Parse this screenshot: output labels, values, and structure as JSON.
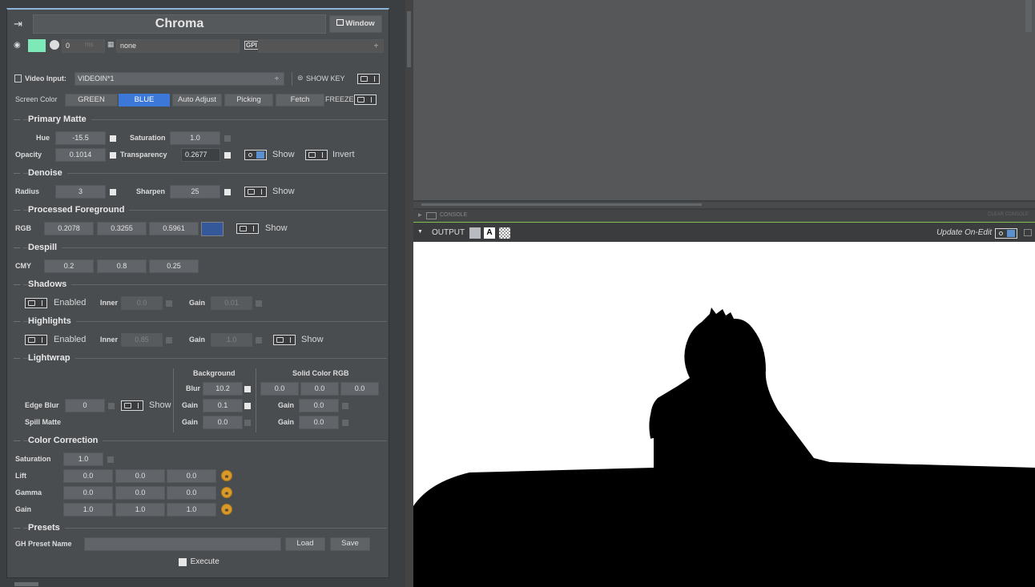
{
  "panel": {
    "title": "Chroma",
    "window_btn": "Window",
    "time_value": "0",
    "time_unit": "ms",
    "layer_value": "none",
    "gpi_label": "GPI",
    "gpi_value": "",
    "video_input_label": "Video Input:",
    "video_input_value": "VIDEOIN*1",
    "show_key": "SHOW KEY",
    "screen_color_label": "Screen Color",
    "green": "GREEN",
    "blue": "BLUE",
    "auto_adjust": "Auto Adjust",
    "picking": "Picking",
    "fetch": "Fetch",
    "freeze": "FREEZE",
    "swatch_color": "#7de8b8"
  },
  "primary": {
    "title": "Primary Matte",
    "hue_label": "Hue",
    "hue": "-15.5",
    "sat_label": "Saturation",
    "sat": "1.0",
    "opacity_label": "Opacity",
    "opacity": "0.1014",
    "transp_label": "Transparency",
    "transp": "0.2677",
    "show": "Show",
    "invert": "Invert"
  },
  "denoise": {
    "title": "Denoise",
    "radius_label": "Radius",
    "radius": "3",
    "sharpen_label": "Sharpen",
    "sharpen": "25",
    "show": "Show"
  },
  "processed": {
    "title": "Processed Foreground",
    "rgb_label": "RGB",
    "r": "0.2078",
    "g": "0.3255",
    "b": "0.5961",
    "show": "Show",
    "swatch": "#35589a"
  },
  "despill": {
    "title": "Despill",
    "cmy_label": "CMY",
    "c": "0.2",
    "m": "0.8",
    "y": "0.25"
  },
  "shadows": {
    "title": "Shadows",
    "enabled": "Enabled",
    "inner_label": "Inner",
    "inner": "0.0",
    "gain_label": "Gain",
    "gain": "0.01"
  },
  "highlights": {
    "title": "Highlights",
    "enabled": "Enabled",
    "inner_label": "Inner",
    "inner": "0.85",
    "gain_label": "Gain",
    "gain": "1.0",
    "show": "Show"
  },
  "lightwrap": {
    "title": "Lightwrap",
    "background": "Background",
    "solid": "Solid Color RGB",
    "blur_label": "Blur",
    "blur": "10.2",
    "s1": "0.0",
    "s2": "0.0",
    "s3": "0.0",
    "edge_blur_label": "Edge Blur",
    "edge_blur": "0",
    "show": "Show",
    "gain_label": "Gain",
    "gain1": "0.1",
    "gain2_label": "Gain",
    "gain2": "0.0",
    "spill_label": "Spill Matte",
    "spill_gain_label": "Gain",
    "spill_gain": "0.0",
    "spill_gain2_label": "Gain",
    "spill_gain2": "0.0"
  },
  "cc": {
    "title": "Color Correction",
    "sat_label": "Saturation",
    "sat": "1.0",
    "lift_label": "Lift",
    "lift": [
      "0.0",
      "0.0",
      "0.0"
    ],
    "gamma_label": "Gamma",
    "gamma": [
      "0.0",
      "0.0",
      "0.0"
    ],
    "gain_label": "Gain",
    "gain": [
      "1.0",
      "1.0",
      "1.0"
    ]
  },
  "presets": {
    "title": "Presets",
    "name_label": "GH Preset Name",
    "name": "",
    "load": "Load",
    "save": "Save"
  },
  "execute": "Execute",
  "console": {
    "label": "CONSOLE",
    "clear": "CLEAR CONSOLE"
  },
  "output": {
    "label": "OUTPUT",
    "update": "Update On-Edit"
  }
}
